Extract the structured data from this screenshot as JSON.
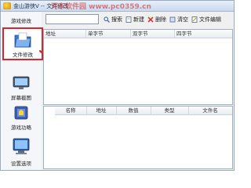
{
  "window": {
    "title": "金山游侠V -- 文件修改"
  },
  "search": {
    "value": ""
  },
  "toolbar": {
    "search_label": "搜索",
    "new_label": "新建",
    "delete_label": "删除",
    "clear_label": "清空",
    "file_edit_label": "文件编辑"
  },
  "sidebar": {
    "items": [
      {
        "label": "游戏修改",
        "icon": "game-modify-icon"
      },
      {
        "label": "文件修改",
        "icon": "folder-icon",
        "selected": true
      },
      {
        "label": "屏幕截图",
        "icon": "screenshot-icon"
      },
      {
        "label": "游戏功略",
        "icon": "game-guide-icon"
      },
      {
        "label": "设置选项",
        "icon": "settings-icon"
      }
    ]
  },
  "upper_table": {
    "columns": [
      "地址",
      "单字节",
      "双字节",
      "四字节"
    ]
  },
  "lower_table": {
    "columns": [
      "名称",
      "地址",
      "数值",
      "类型",
      "文件名"
    ]
  },
  "watermark": "河东软件园 www.pc0359.cn",
  "colors": {
    "selection_border": "#d9262c",
    "arrow": "#d9262c",
    "accent": "#3a78c9"
  }
}
